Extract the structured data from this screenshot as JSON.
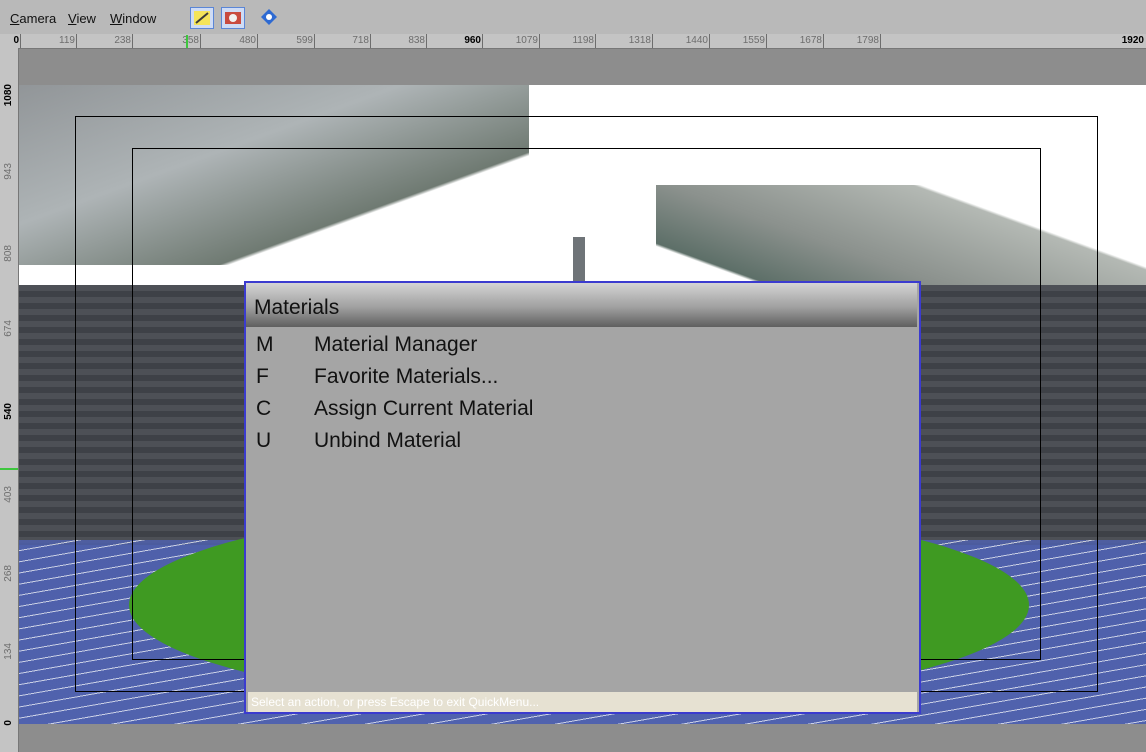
{
  "menubar": {
    "camera": {
      "accel": "C",
      "rest": "amera"
    },
    "view": {
      "accel": "V",
      "rest": "iew"
    },
    "window": {
      "accel": "W",
      "rest": "indow"
    }
  },
  "toolbar": {
    "icons": [
      "pen-tool-icon",
      "camera-view-icon",
      "diamond-snap-icon"
    ]
  },
  "ruler_top": [
    "0",
    "119",
    "238",
    "358",
    "480",
    "599",
    "718",
    "838",
    "960",
    "1079",
    "1198",
    "1318",
    "1440",
    "1559",
    "1678",
    "1798",
    "1920"
  ],
  "ruler_left": [
    "1080",
    "943",
    "808",
    "674",
    "540",
    "403",
    "268",
    "134",
    "0"
  ],
  "quickmenu": {
    "title": "Materials",
    "items": [
      {
        "key": "M",
        "label": "Material Manager"
      },
      {
        "key": "F",
        "label": "Favorite Materials..."
      },
      {
        "key": "C",
        "label": "Assign Current Material"
      },
      {
        "key": "U",
        "label": "Unbind Material"
      }
    ],
    "status": "Select an action, or press Escape to exit QuickMenu..."
  },
  "colors": {
    "menu_border": "#3b3bcf",
    "ruler_marker": "#3ec63e"
  }
}
